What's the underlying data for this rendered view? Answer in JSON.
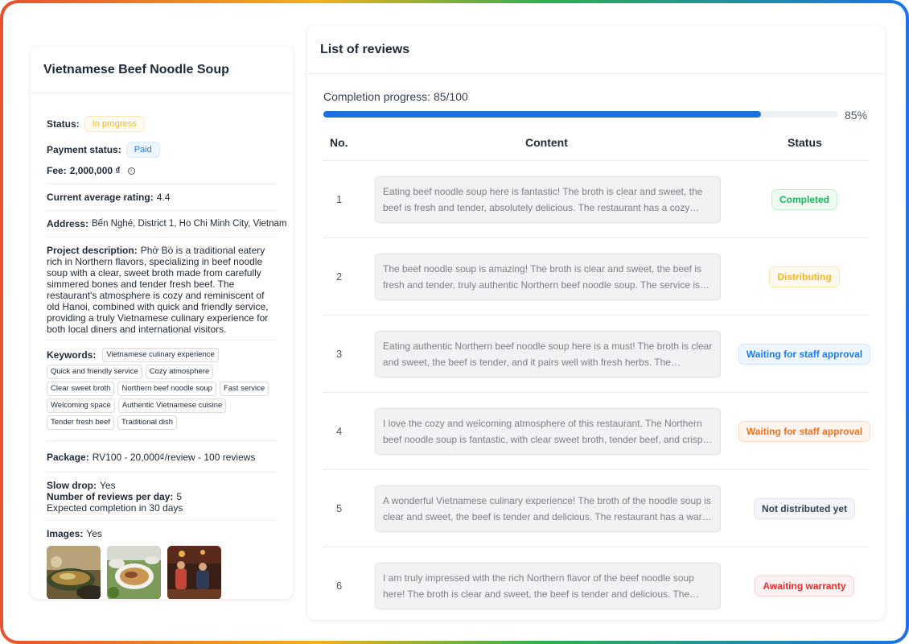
{
  "project": {
    "title": "Vietnamese Beef Noodle Soup",
    "status_label": "Status:",
    "status_value": "In progress",
    "payment_label": "Payment status:",
    "payment_value": "Paid",
    "fee_label": "Fee:",
    "fee_value": "2,000,000 ₫",
    "fee_icon": "info-icon",
    "rating_label": "Current average rating:",
    "rating_value": "4.4",
    "address_label": "Address:",
    "address_value": "Bến Nghé, District 1, Ho Chi Minh City, Vietnam",
    "description_label": "Project description:",
    "description_value": "Phở Bò is a traditional eatery rich in Northern flavors, specializing in beef noodle soup with a clear, sweet broth made from carefully simmered bones and tender fresh beef. The restaurant's atmosphere is cozy and reminiscent of old Hanoi, combined with quick and friendly service, providing a truly Vietnamese culinary experience for both local diners and international visitors.",
    "keywords_label": "Keywords:",
    "keywords": [
      "Vietnamese culinary experience",
      "Quick and friendly service",
      "Cozy atmosphere",
      "Clear sweet broth",
      "Northern beef noodle soup",
      "Fast service",
      "Welcoming space",
      "Authentic Vietnamese cuisine",
      "Tender fresh beef",
      "Traditional dish"
    ],
    "package_label": "Package:",
    "package_value": "RV100 - 20,000₫/review - 100 reviews",
    "slow_drop_label": "Slow drop:",
    "slow_drop_value": "Yes",
    "reviews_per_day_label": "Number of reviews per day:",
    "reviews_per_day_value": "5",
    "expected_completion": "Expected completion in 30 days",
    "images_label": "Images:",
    "images_value": "Yes"
  },
  "reviews": {
    "title": "List of reviews",
    "progress_text": "Completion progress: 85/100",
    "progress_fraction": 0.85,
    "progress_percent_text": "85%",
    "columns": {
      "no": "No.",
      "content": "Content",
      "status": "Status"
    },
    "rows": [
      {
        "no": "1",
        "content": "Eating beef noodle soup here is fantastic! The broth is clear and sweet, the beef is fresh and tender, absolutely delicious. The restaurant has a cozy atmosphere.",
        "status": "Completed",
        "variant": "green"
      },
      {
        "no": "2",
        "content": "The beef noodle soup is amazing! The broth is clear and sweet, the beef is fresh and tender, truly authentic Northern beef noodle soup. The service is quick.",
        "status": "Distributing",
        "variant": "yellow"
      },
      {
        "no": "3",
        "content": "Eating authentic Northern beef noodle soup here is a must! The broth is clear and sweet, the beef is tender, and it pairs well with fresh herbs. The restaurant is welcoming.",
        "status": "Waiting for staff approval",
        "variant": "blue"
      },
      {
        "no": "4",
        "content": "I love the cozy and welcoming atmosphere of this restaurant. The Northern beef noodle soup is fantastic, with clear sweet broth, tender beef, and crisp herbs.",
        "status": "Waiting for staff approval",
        "variant": "orange"
      },
      {
        "no": "5",
        "content": "A wonderful Vietnamese culinary experience! The broth of the noodle soup is clear and sweet, the beef is tender and delicious. The restaurant has a warm feel.",
        "status": "Not distributed yet",
        "variant": "gray"
      },
      {
        "no": "6",
        "content": "I am truly impressed with the rich Northern flavor of the beef noodle soup here! The broth is clear and sweet, the beef is tender and delicious. The restaurant is cozy.",
        "status": "Awaiting warranty",
        "variant": "red"
      }
    ]
  },
  "colors": {
    "accent": "#1a6fe3",
    "completed": "#1eb75f",
    "distributing": "#f3b629",
    "waiting_blue": "#1d7df0",
    "waiting_orange": "#f17422",
    "not_distributed": "#374151",
    "warranty": "#ea2b2b"
  }
}
